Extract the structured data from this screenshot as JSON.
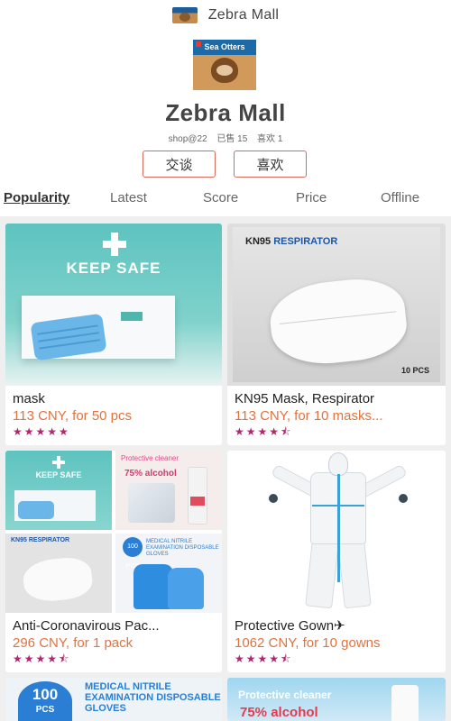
{
  "header": {
    "title": "Zebra Mall"
  },
  "shop": {
    "avatar_text": "Sea Otters",
    "name": "Zebra Mall",
    "handle": "shop@22",
    "sold": "已售 15",
    "likes": "喜欢 1",
    "talk_button": "交谈",
    "like_button": "喜欢"
  },
  "tabs": [
    "Popularity",
    "Latest",
    "Score",
    "Price",
    "Offline"
  ],
  "products": [
    {
      "name": "mask",
      "price": "113 CNY, for 50 pcs",
      "stars": "★★★★★",
      "image_text": "KEEP SAFE"
    },
    {
      "name": "KN95 Mask, Respirator",
      "price": "113 CNY, for 10 masks...",
      "stars": "★★★★⯪",
      "image_label_a": "KN95 ",
      "image_label_b": "RESPIRATOR",
      "image_pcs": "10 PCS"
    },
    {
      "name": "Anti-Coronavirous Pac...",
      "price": "296 CNY, for 1 pack",
      "stars": "★★★★⯪",
      "image_text_a": "KEEP SAFE",
      "image_text_b": "Protective cleaner",
      "image_text_c": "75% alcohol",
      "image_text_d": "KN95 RESPIRATOR",
      "image_text_e": "100 PCS",
      "image_text_f": "MEDICAL NITRILE EXAMINATION DISPOSABLE GLOVES"
    },
    {
      "name": "Protective Gown",
      "price": "1062 CNY, for 10 gowns",
      "stars": "★★★★⯪"
    }
  ],
  "partial": {
    "left_circle_num": "100",
    "left_circle_unit": "PCS",
    "left_text": "MEDICAL NITRILE EXAMINATION DISPOSABLE GLOVES",
    "right_text": "Protective cleaner",
    "right_text2": "75% alcohol"
  }
}
